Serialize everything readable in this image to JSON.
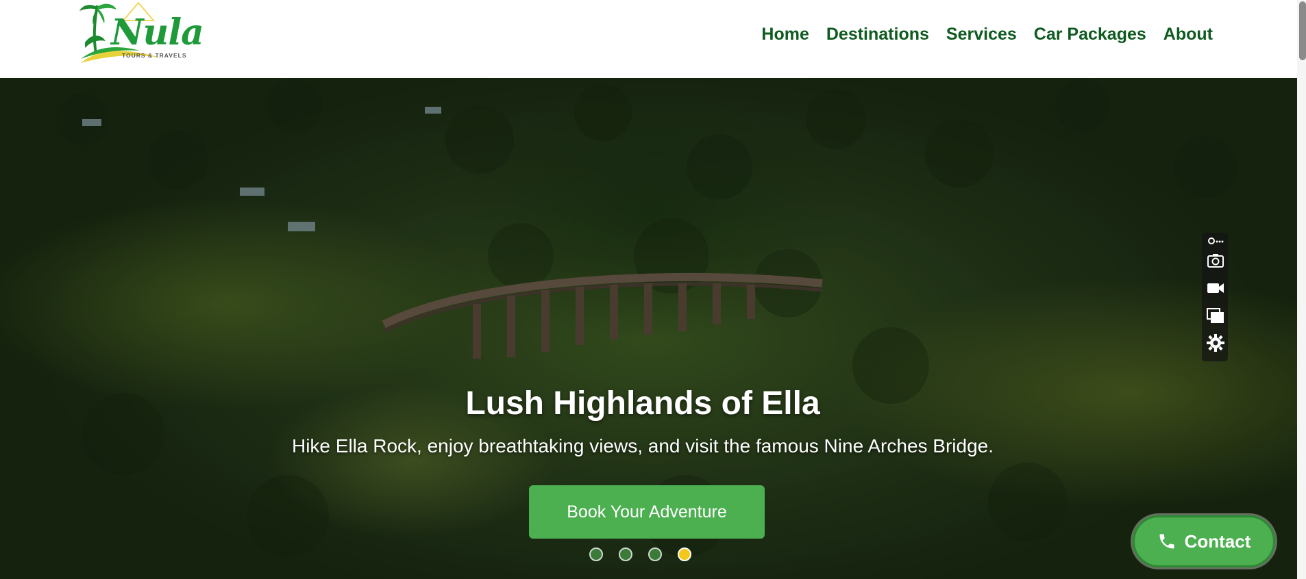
{
  "brand": {
    "name": "Nula",
    "tagline": "TOURS & TRAVELS",
    "accent_color": "#1f9a3a"
  },
  "nav": {
    "items": [
      {
        "label": "Home"
      },
      {
        "label": "Destinations"
      },
      {
        "label": "Services"
      },
      {
        "label": "Car Packages"
      },
      {
        "label": "About"
      }
    ],
    "color": "#0e5a1f"
  },
  "hero": {
    "title": "Lush Highlands of Ella",
    "subtitle": "Hike Ella Rock, enjoy breathtaking views, and visit the famous Nine Arches Bridge.",
    "cta_label": "Book Your Adventure",
    "cta_color": "#4caf50",
    "slides": {
      "count": 4,
      "active_index": 3
    },
    "background": "aerial-forest-with-arched-railway-bridge"
  },
  "toolbar": {
    "icons": [
      "link-more-icon",
      "camera-icon",
      "video-icon",
      "copy-window-icon",
      "gear-icon"
    ]
  },
  "contact": {
    "label": "Contact",
    "icon": "phone-icon"
  }
}
